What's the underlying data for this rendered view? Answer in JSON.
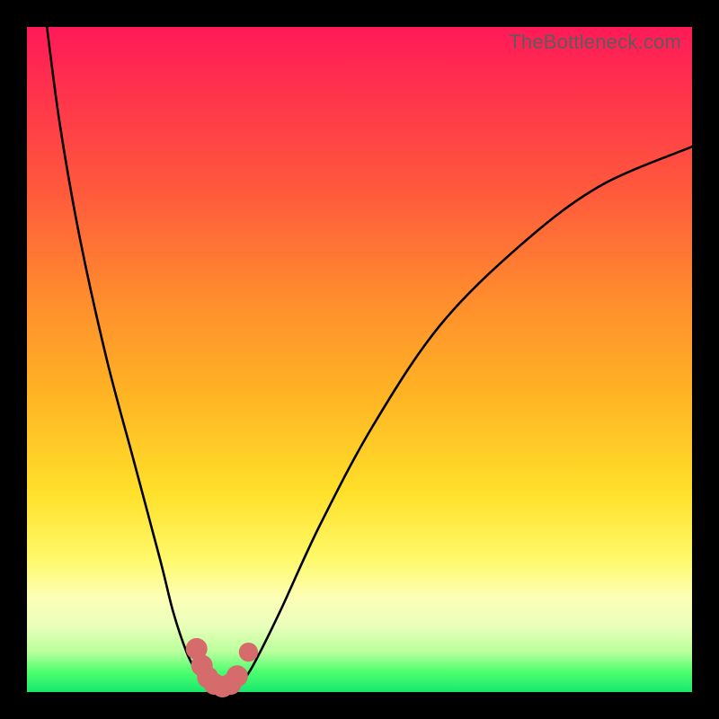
{
  "watermark": "TheBottleneck.com",
  "colors": {
    "curve_stroke": "#000000",
    "marker_fill": "#d66b6b",
    "marker_stroke": "#d66b6b"
  },
  "chart_data": {
    "type": "line",
    "title": "",
    "xlabel": "",
    "ylabel": "",
    "xlim": [
      0,
      100
    ],
    "ylim": [
      0,
      100
    ],
    "note": "Bottleneck-style V curve on a red→green vertical gradient. No axes/ticks shown. Values below are pixel-relative percentages (0–100 each axis, origin bottom-left) estimated from the image.",
    "series": [
      {
        "name": "left-branch",
        "x": [
          3,
          5,
          8,
          12,
          16,
          20,
          22,
          24,
          25.5,
          26.5,
          27
        ],
        "y": [
          100,
          85,
          68,
          50,
          35,
          20,
          12,
          6,
          3,
          1.5,
          1
        ]
      },
      {
        "name": "valley",
        "x": [
          27,
          28,
          29,
          30,
          31,
          32
        ],
        "y": [
          1,
          0.5,
          0.3,
          0.3,
          0.5,
          1
        ]
      },
      {
        "name": "right-branch",
        "x": [
          32,
          34,
          38,
          44,
          52,
          62,
          74,
          86,
          100
        ],
        "y": [
          1,
          4,
          12,
          25,
          40,
          55,
          67,
          76,
          82
        ]
      }
    ],
    "markers": {
      "name": "valley-points",
      "points": [
        {
          "x": 25.5,
          "y": 6.5,
          "r": 1.2
        },
        {
          "x": 26.3,
          "y": 4.0,
          "r": 1.2
        },
        {
          "x": 27.2,
          "y": 2.2,
          "r": 1.2
        },
        {
          "x": 28.2,
          "y": 1.2,
          "r": 1.2
        },
        {
          "x": 29.4,
          "y": 0.8,
          "r": 1.2
        },
        {
          "x": 30.6,
          "y": 1.2,
          "r": 1.2
        },
        {
          "x": 31.6,
          "y": 2.4,
          "r": 1.2
        },
        {
          "x": 33.3,
          "y": 6.0,
          "r": 1.0
        }
      ]
    }
  }
}
